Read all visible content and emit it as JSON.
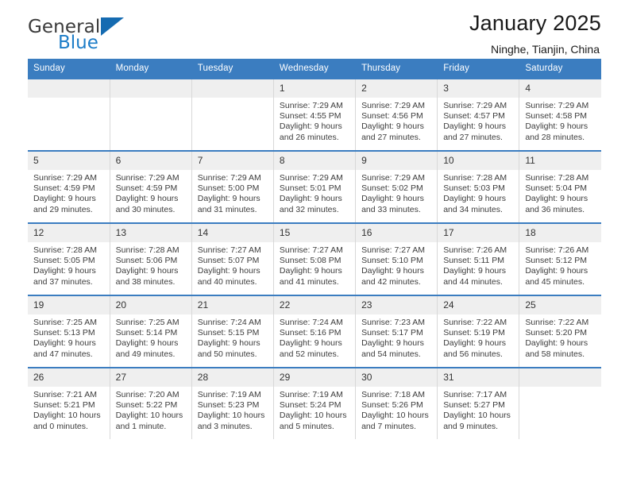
{
  "brand": {
    "name_top": "General",
    "name_bottom": "Blue",
    "triangle_color": "#156bb1",
    "blue_color": "#1d7dc8"
  },
  "header": {
    "title": "January 2025",
    "subtitle": "Ninghe, Tianjin, China"
  },
  "theme": {
    "header_bg": "#3b7dc0",
    "daynum_bg": "#efefef",
    "grid_line": "#d8d8d8"
  },
  "weekday_headers": [
    "Sunday",
    "Monday",
    "Tuesday",
    "Wednesday",
    "Thursday",
    "Friday",
    "Saturday"
  ],
  "labels": {
    "sunrise_prefix": "Sunrise:",
    "sunset_prefix": "Sunset:",
    "daylight_prefix": "Daylight:"
  },
  "weeks": [
    [
      {
        "day": "",
        "empty": true
      },
      {
        "day": "",
        "empty": true
      },
      {
        "day": "",
        "empty": true
      },
      {
        "day": "1",
        "sunrise": "Sunrise: 7:29 AM",
        "sunset": "Sunset: 4:55 PM",
        "daylight1": "Daylight: 9 hours",
        "daylight2": "and 26 minutes."
      },
      {
        "day": "2",
        "sunrise": "Sunrise: 7:29 AM",
        "sunset": "Sunset: 4:56 PM",
        "daylight1": "Daylight: 9 hours",
        "daylight2": "and 27 minutes."
      },
      {
        "day": "3",
        "sunrise": "Sunrise: 7:29 AM",
        "sunset": "Sunset: 4:57 PM",
        "daylight1": "Daylight: 9 hours",
        "daylight2": "and 27 minutes."
      },
      {
        "day": "4",
        "sunrise": "Sunrise: 7:29 AM",
        "sunset": "Sunset: 4:58 PM",
        "daylight1": "Daylight: 9 hours",
        "daylight2": "and 28 minutes."
      }
    ],
    [
      {
        "day": "5",
        "sunrise": "Sunrise: 7:29 AM",
        "sunset": "Sunset: 4:59 PM",
        "daylight1": "Daylight: 9 hours",
        "daylight2": "and 29 minutes."
      },
      {
        "day": "6",
        "sunrise": "Sunrise: 7:29 AM",
        "sunset": "Sunset: 4:59 PM",
        "daylight1": "Daylight: 9 hours",
        "daylight2": "and 30 minutes."
      },
      {
        "day": "7",
        "sunrise": "Sunrise: 7:29 AM",
        "sunset": "Sunset: 5:00 PM",
        "daylight1": "Daylight: 9 hours",
        "daylight2": "and 31 minutes."
      },
      {
        "day": "8",
        "sunrise": "Sunrise: 7:29 AM",
        "sunset": "Sunset: 5:01 PM",
        "daylight1": "Daylight: 9 hours",
        "daylight2": "and 32 minutes."
      },
      {
        "day": "9",
        "sunrise": "Sunrise: 7:29 AM",
        "sunset": "Sunset: 5:02 PM",
        "daylight1": "Daylight: 9 hours",
        "daylight2": "and 33 minutes."
      },
      {
        "day": "10",
        "sunrise": "Sunrise: 7:28 AM",
        "sunset": "Sunset: 5:03 PM",
        "daylight1": "Daylight: 9 hours",
        "daylight2": "and 34 minutes."
      },
      {
        "day": "11",
        "sunrise": "Sunrise: 7:28 AM",
        "sunset": "Sunset: 5:04 PM",
        "daylight1": "Daylight: 9 hours",
        "daylight2": "and 36 minutes."
      }
    ],
    [
      {
        "day": "12",
        "sunrise": "Sunrise: 7:28 AM",
        "sunset": "Sunset: 5:05 PM",
        "daylight1": "Daylight: 9 hours",
        "daylight2": "and 37 minutes."
      },
      {
        "day": "13",
        "sunrise": "Sunrise: 7:28 AM",
        "sunset": "Sunset: 5:06 PM",
        "daylight1": "Daylight: 9 hours",
        "daylight2": "and 38 minutes."
      },
      {
        "day": "14",
        "sunrise": "Sunrise: 7:27 AM",
        "sunset": "Sunset: 5:07 PM",
        "daylight1": "Daylight: 9 hours",
        "daylight2": "and 40 minutes."
      },
      {
        "day": "15",
        "sunrise": "Sunrise: 7:27 AM",
        "sunset": "Sunset: 5:08 PM",
        "daylight1": "Daylight: 9 hours",
        "daylight2": "and 41 minutes."
      },
      {
        "day": "16",
        "sunrise": "Sunrise: 7:27 AM",
        "sunset": "Sunset: 5:10 PM",
        "daylight1": "Daylight: 9 hours",
        "daylight2": "and 42 minutes."
      },
      {
        "day": "17",
        "sunrise": "Sunrise: 7:26 AM",
        "sunset": "Sunset: 5:11 PM",
        "daylight1": "Daylight: 9 hours",
        "daylight2": "and 44 minutes."
      },
      {
        "day": "18",
        "sunrise": "Sunrise: 7:26 AM",
        "sunset": "Sunset: 5:12 PM",
        "daylight1": "Daylight: 9 hours",
        "daylight2": "and 45 minutes."
      }
    ],
    [
      {
        "day": "19",
        "sunrise": "Sunrise: 7:25 AM",
        "sunset": "Sunset: 5:13 PM",
        "daylight1": "Daylight: 9 hours",
        "daylight2": "and 47 minutes."
      },
      {
        "day": "20",
        "sunrise": "Sunrise: 7:25 AM",
        "sunset": "Sunset: 5:14 PM",
        "daylight1": "Daylight: 9 hours",
        "daylight2": "and 49 minutes."
      },
      {
        "day": "21",
        "sunrise": "Sunrise: 7:24 AM",
        "sunset": "Sunset: 5:15 PM",
        "daylight1": "Daylight: 9 hours",
        "daylight2": "and 50 minutes."
      },
      {
        "day": "22",
        "sunrise": "Sunrise: 7:24 AM",
        "sunset": "Sunset: 5:16 PM",
        "daylight1": "Daylight: 9 hours",
        "daylight2": "and 52 minutes."
      },
      {
        "day": "23",
        "sunrise": "Sunrise: 7:23 AM",
        "sunset": "Sunset: 5:17 PM",
        "daylight1": "Daylight: 9 hours",
        "daylight2": "and 54 minutes."
      },
      {
        "day": "24",
        "sunrise": "Sunrise: 7:22 AM",
        "sunset": "Sunset: 5:19 PM",
        "daylight1": "Daylight: 9 hours",
        "daylight2": "and 56 minutes."
      },
      {
        "day": "25",
        "sunrise": "Sunrise: 7:22 AM",
        "sunset": "Sunset: 5:20 PM",
        "daylight1": "Daylight: 9 hours",
        "daylight2": "and 58 minutes."
      }
    ],
    [
      {
        "day": "26",
        "sunrise": "Sunrise: 7:21 AM",
        "sunset": "Sunset: 5:21 PM",
        "daylight1": "Daylight: 10 hours",
        "daylight2": "and 0 minutes."
      },
      {
        "day": "27",
        "sunrise": "Sunrise: 7:20 AM",
        "sunset": "Sunset: 5:22 PM",
        "daylight1": "Daylight: 10 hours",
        "daylight2": "and 1 minute."
      },
      {
        "day": "28",
        "sunrise": "Sunrise: 7:19 AM",
        "sunset": "Sunset: 5:23 PM",
        "daylight1": "Daylight: 10 hours",
        "daylight2": "and 3 minutes."
      },
      {
        "day": "29",
        "sunrise": "Sunrise: 7:19 AM",
        "sunset": "Sunset: 5:24 PM",
        "daylight1": "Daylight: 10 hours",
        "daylight2": "and 5 minutes."
      },
      {
        "day": "30",
        "sunrise": "Sunrise: 7:18 AM",
        "sunset": "Sunset: 5:26 PM",
        "daylight1": "Daylight: 10 hours",
        "daylight2": "and 7 minutes."
      },
      {
        "day": "31",
        "sunrise": "Sunrise: 7:17 AM",
        "sunset": "Sunset: 5:27 PM",
        "daylight1": "Daylight: 10 hours",
        "daylight2": "and 9 minutes."
      },
      {
        "day": "",
        "empty": true
      }
    ]
  ]
}
